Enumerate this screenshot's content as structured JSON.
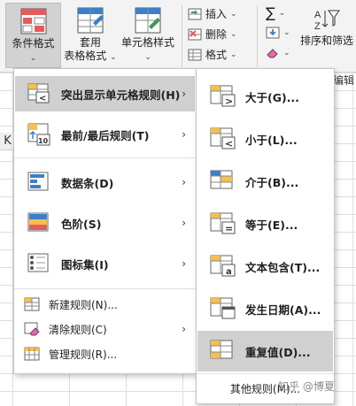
{
  "ribbon": {
    "conditional_format": "条件格式",
    "table_format": [
      "套用",
      "表格格式"
    ],
    "cell_style": "单元格样式",
    "insert": "插入",
    "delete": "删除",
    "format": "格式",
    "sort_filter": "排序和筛选",
    "edit_group": "编辑",
    "sigma": "∑"
  },
  "column_header": "K",
  "main_menu": {
    "items": [
      {
        "label": "突出显示单元格规则(H)",
        "shortcut": "H"
      },
      {
        "label": "最前/最后规则(T)",
        "shortcut": "T"
      },
      {
        "label": "数据条(D)",
        "shortcut": "D"
      },
      {
        "label": "色阶(S)",
        "shortcut": "S"
      },
      {
        "label": "图标集(I)",
        "shortcut": "I"
      }
    ],
    "small_items": [
      {
        "label": "新建规则(N)..."
      },
      {
        "label": "清除规则(C)"
      },
      {
        "label": "管理规则(R)..."
      }
    ]
  },
  "sub_menu": {
    "items": [
      {
        "label": "大于(G)..."
      },
      {
        "label": "小于(L)..."
      },
      {
        "label": "介于(B)..."
      },
      {
        "label": "等于(E)..."
      },
      {
        "label": "文本包含(T)..."
      },
      {
        "label": "发生日期(A)..."
      },
      {
        "label": "重复值(D)..."
      }
    ],
    "more_rules": "其他规则(M)..."
  },
  "icon_text": {
    "top10": "10",
    "greater": ">",
    "less": "<",
    "equals": "=",
    "text_a": "a"
  },
  "watermark": "知乎 @博夏",
  "colors": {
    "highlight": "#d0d0d0",
    "red": "#e45b5b",
    "blue": "#3d7fc8",
    "yellow": "#f2c14e",
    "green": "#3a9b5c"
  }
}
